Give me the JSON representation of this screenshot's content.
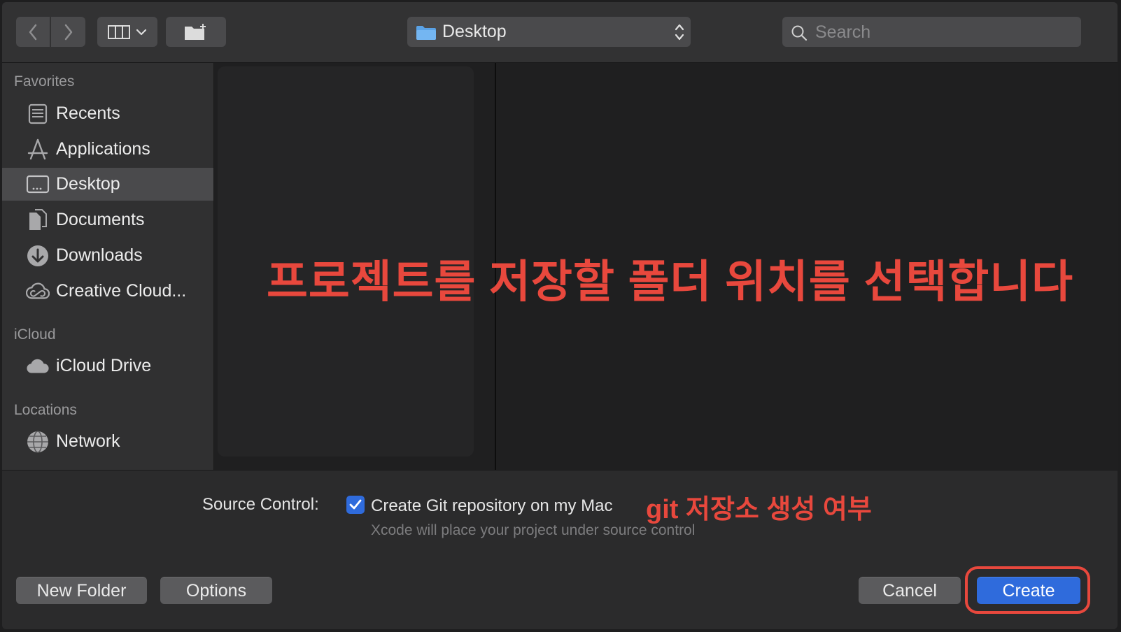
{
  "toolbar": {
    "location_label": "Desktop",
    "search_placeholder": "Search"
  },
  "sidebar": {
    "sections": [
      {
        "title": "Favorites",
        "items": [
          {
            "label": "Recents",
            "icon": "recents-icon",
            "selected": false
          },
          {
            "label": "Applications",
            "icon": "applications-icon",
            "selected": false
          },
          {
            "label": "Desktop",
            "icon": "desktop-icon",
            "selected": true
          },
          {
            "label": "Documents",
            "icon": "documents-icon",
            "selected": false
          },
          {
            "label": "Downloads",
            "icon": "downloads-icon",
            "selected": false
          },
          {
            "label": "Creative Cloud...",
            "icon": "creative-cloud-icon",
            "selected": false
          }
        ]
      },
      {
        "title": "iCloud",
        "items": [
          {
            "label": "iCloud Drive",
            "icon": "icloud-icon",
            "selected": false
          }
        ]
      },
      {
        "title": "Locations",
        "items": [
          {
            "label": "Network",
            "icon": "network-icon",
            "selected": false
          }
        ]
      }
    ]
  },
  "annotations": {
    "folder_hint": "프로젝트를 저장할 폴더 위치를 선택합니다",
    "git_hint": "git 저장소 생성 여부"
  },
  "source_control": {
    "label": "Source Control:",
    "checkbox_label": "Create Git repository on my Mac",
    "checked": true,
    "description": "Xcode will place your project under source control"
  },
  "buttons": {
    "new_folder": "New Folder",
    "options": "Options",
    "cancel": "Cancel",
    "create": "Create"
  },
  "colors": {
    "accent": "#2f6bdc",
    "annotation": "#e8483d"
  }
}
